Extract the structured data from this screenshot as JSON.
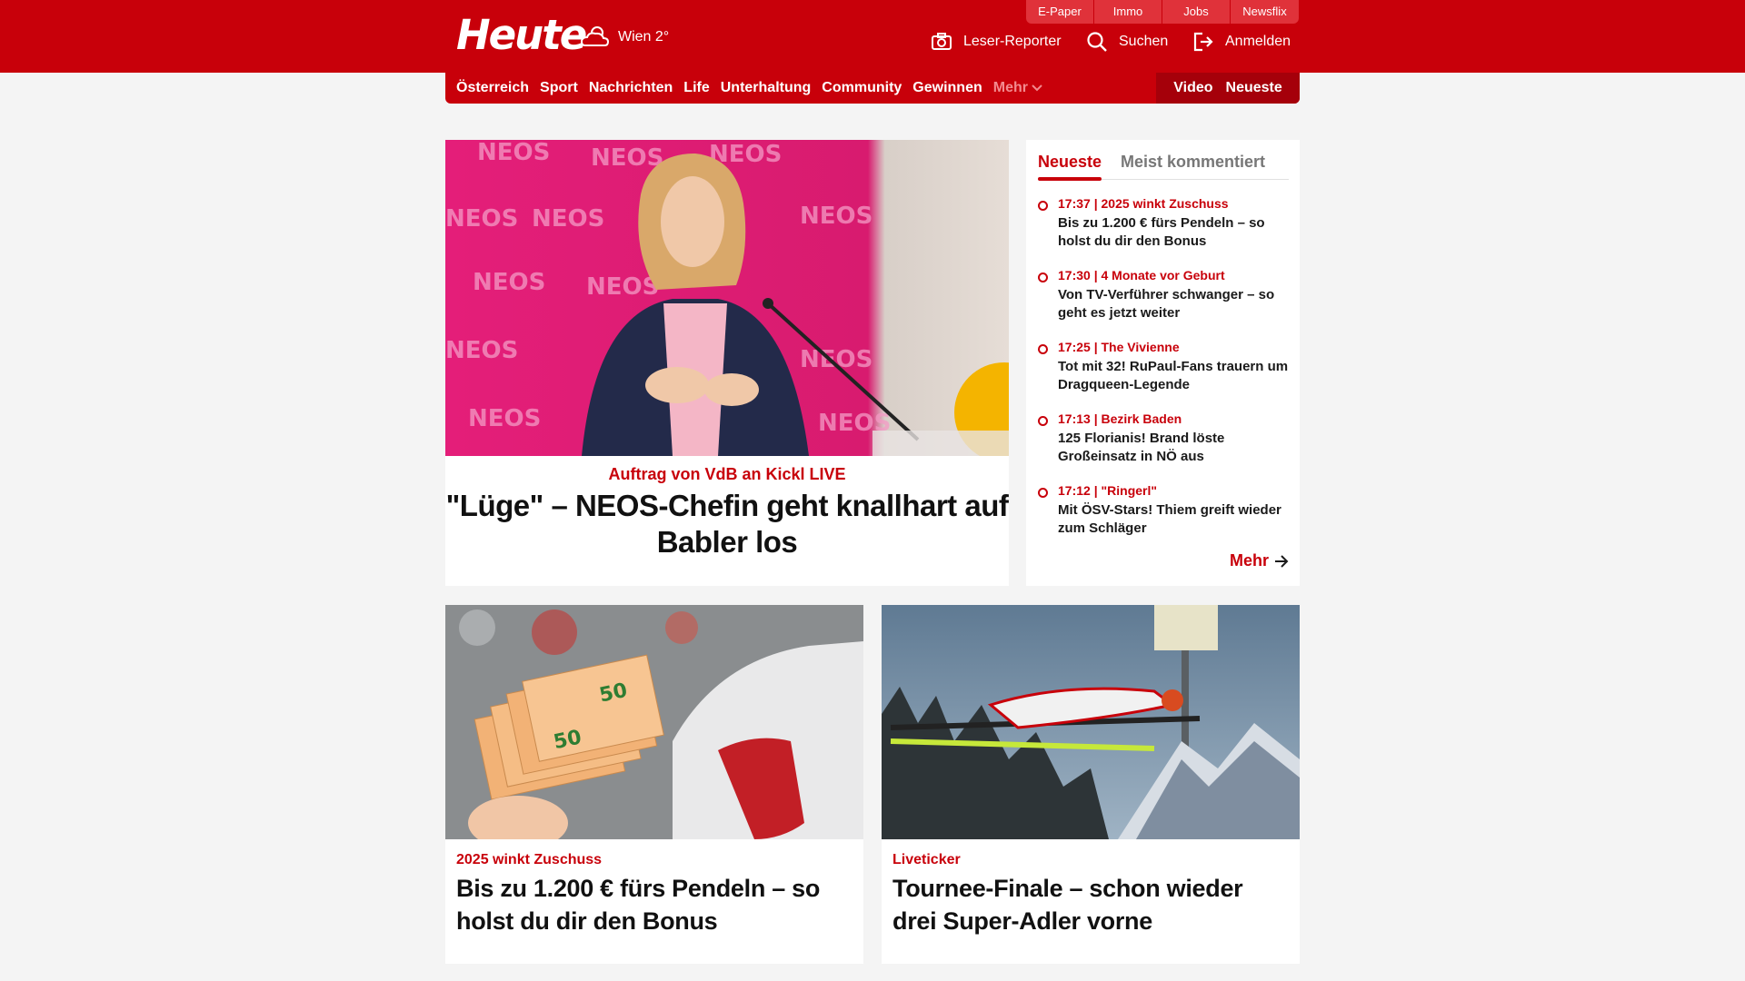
{
  "header": {
    "logo": "Heute",
    "weather": "Wien 2°",
    "top_links": [
      "E-Paper",
      "Immo",
      "Jobs",
      "Newsflix"
    ],
    "tools": {
      "reporter": "Leser-Reporter",
      "search": "Suchen",
      "login": "Anmelden"
    }
  },
  "nav": {
    "items": [
      "Österreich",
      "Sport",
      "Nachrichten",
      "Life",
      "Unterhaltung",
      "Community",
      "Gewinnen"
    ],
    "more": "Mehr",
    "right": [
      "Video",
      "Neueste"
    ]
  },
  "hero": {
    "kicker": "Auftrag von VdB an Kickl LIVE",
    "title": "\"Lüge\" – NEOS-Chefin geht knallhart auf Babler los",
    "image_text": "NEOS"
  },
  "sidebar": {
    "tabs": [
      "Neueste",
      "Meist kommentiert"
    ],
    "items": [
      {
        "meta": "17:37 | 2025 winkt Zuschuss",
        "title": "Bis zu 1.200 € fürs Pendeln – so holst du dir den Bonus"
      },
      {
        "meta": "17:30 | 4 Monate vor Geburt",
        "title": "Von TV-Verführer schwanger – so geht es jetzt weiter"
      },
      {
        "meta": "17:25 | The Vivienne",
        "title": "Tot mit 32! RuPaul-Fans trauern um Dragqueen-Legende"
      },
      {
        "meta": "17:13 | Bezirk Baden",
        "title": "125 Florianis! Brand löste Großeinsatz in NÖ aus"
      },
      {
        "meta": "17:12 | \"Ringerl\"",
        "title": "Mit ÖSV-Stars! Thiem greift wieder zum Schläger"
      }
    ],
    "more": "Mehr"
  },
  "cards": [
    {
      "kicker": "2025 winkt Zuschuss",
      "title": "Bis zu 1.200 € fürs Pendeln – so holst du dir den Bonus"
    },
    {
      "kicker": "Liveticker",
      "title": "Tournee-Finale  – schon wieder drei Super-Adler vorne"
    }
  ],
  "colors": {
    "brand_red": "#c8000a",
    "dark_red": "#a5000a",
    "background": "#f4f4f4"
  }
}
